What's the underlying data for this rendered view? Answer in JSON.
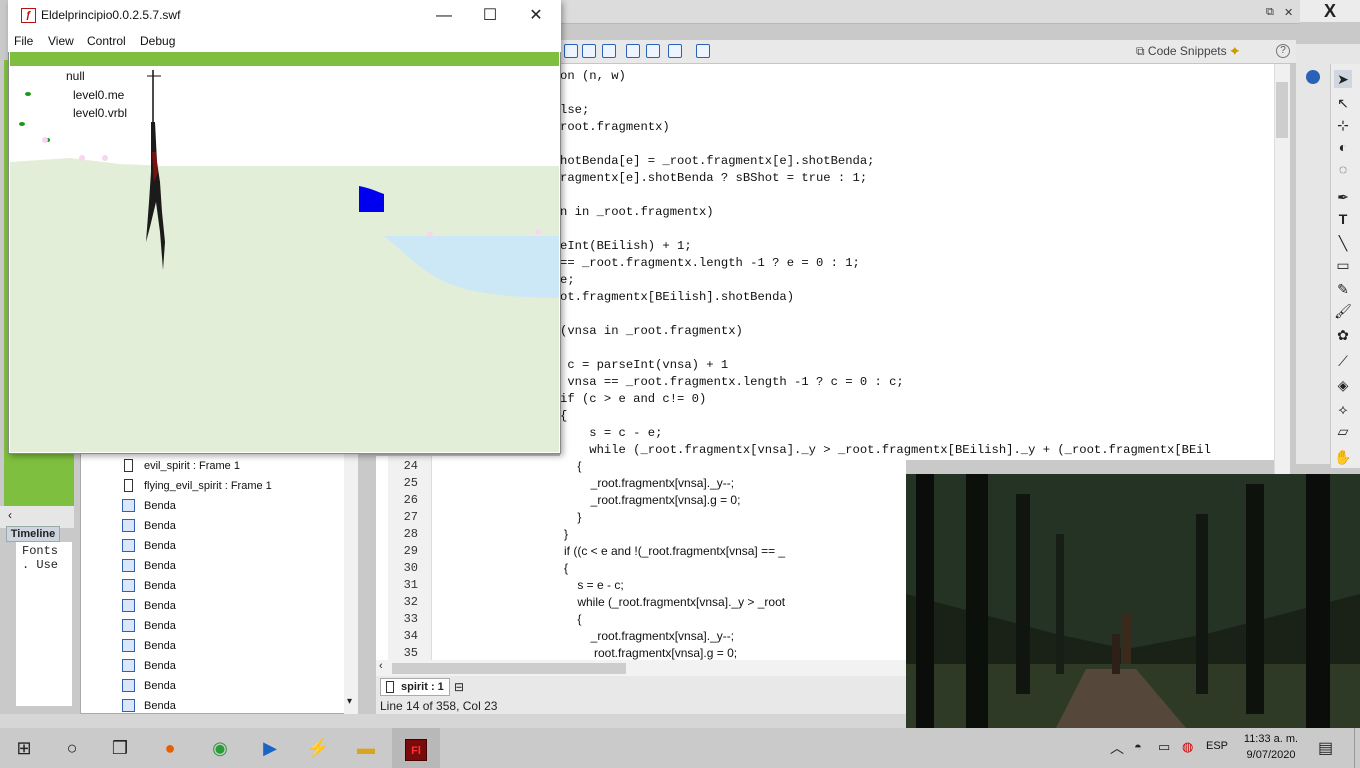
{
  "flash_player": {
    "title": "Eldelprincipio0.0.2.5.7.swf",
    "menu": [
      "File",
      "View",
      "Control",
      "Debug"
    ],
    "window_controls": {
      "minimize": "—",
      "maximize": "☐",
      "close": "✕"
    },
    "debug_text": {
      "line1": "null",
      "line2": "level0.me",
      "line3": "level0.vrbl"
    }
  },
  "ide": {
    "code_snippets_label": "Code Snippets",
    "help": "?",
    "close": "X",
    "code_lines": [
      "on (n, w)",
      "",
      "lse;",
      "root.fragmentx)",
      "",
      "hotBenda[e] = _root.fragmentx[e].shotBenda;",
      "ragmentx[e].shotBenda ? sBShot = true : 1;",
      "",
      "n in _root.fragmentx)",
      "",
      "eInt(BEilish) + 1;",
      "== _root.fragmentx.length -1 ? e = 0 : 1;",
      "e;",
      "ot.fragmentx[BEilish].shotBenda)",
      "",
      "(vnsa in _root.fragmentx)",
      "",
      " c = parseInt(vnsa) + 1",
      " vnsa == _root.fragmentx.length -1 ? c = 0 : c;",
      "if (c > e and c!= 0)",
      "{",
      "    s = c - e;",
      "    while (_root.fragmentx[vnsa]._y > _root.fragmentx[BEilish]._y + (_root.fragmentx[BEil"
    ],
    "line_numbers": [
      "24",
      "25",
      "26",
      "27",
      "28",
      "29",
      "30",
      "31",
      "32",
      "33",
      "34",
      "35"
    ],
    "code_lines_2": [
      "    {",
      "        _root.fragmentx[vnsa]._y--;",
      "        _root.fragmentx[vnsa].g = 0;",
      "    }",
      "}",
      "if ((c < e and !(_root.fragmentx[vnsa] == _",
      "{",
      "    s = e - c;",
      "    while (_root.fragmentx[vnsa]._y > _root",
      "    {",
      "        _root.fragmentx[vnsa]._y--;",
      "         root.fragmentx[vnsa].g = 0;"
    ],
    "script_tab": "spirit : 1",
    "status": "Line 14 of 358, Col 23",
    "timeline_tab": "Timeline",
    "fonts_text": [
      "Fonts",
      ". Use"
    ],
    "library_items": [
      {
        "label": "evil_spirit : Frame 1",
        "kind": "frame"
      },
      {
        "label": "flying_evil_spirit : Frame 1",
        "kind": "frame"
      },
      {
        "label": "Benda",
        "kind": "symbol"
      },
      {
        "label": "Benda",
        "kind": "symbol"
      },
      {
        "label": "Benda",
        "kind": "symbol"
      },
      {
        "label": "Benda",
        "kind": "symbol"
      },
      {
        "label": "Benda",
        "kind": "symbol"
      },
      {
        "label": "Benda",
        "kind": "symbol"
      },
      {
        "label": "Benda",
        "kind": "symbol"
      },
      {
        "label": "Benda",
        "kind": "symbol"
      },
      {
        "label": "Benda",
        "kind": "symbol"
      },
      {
        "label": "Benda",
        "kind": "symbol"
      },
      {
        "label": "Benda",
        "kind": "symbol"
      }
    ]
  },
  "taskbar": {
    "lang": "ESP",
    "time": "11:33 a. m.",
    "date": "9/07/2020",
    "apps": [
      "start-icon",
      "search-icon",
      "task-view-icon",
      "firefox-icon",
      "chrome-icon",
      "media-player-icon",
      "winamp-icon",
      "file-explorer-icon",
      "flash-icon"
    ]
  },
  "colors": {
    "stage_green": "#7ebf3f",
    "water": "#cce8f7",
    "blue_block": "#0000ee"
  }
}
